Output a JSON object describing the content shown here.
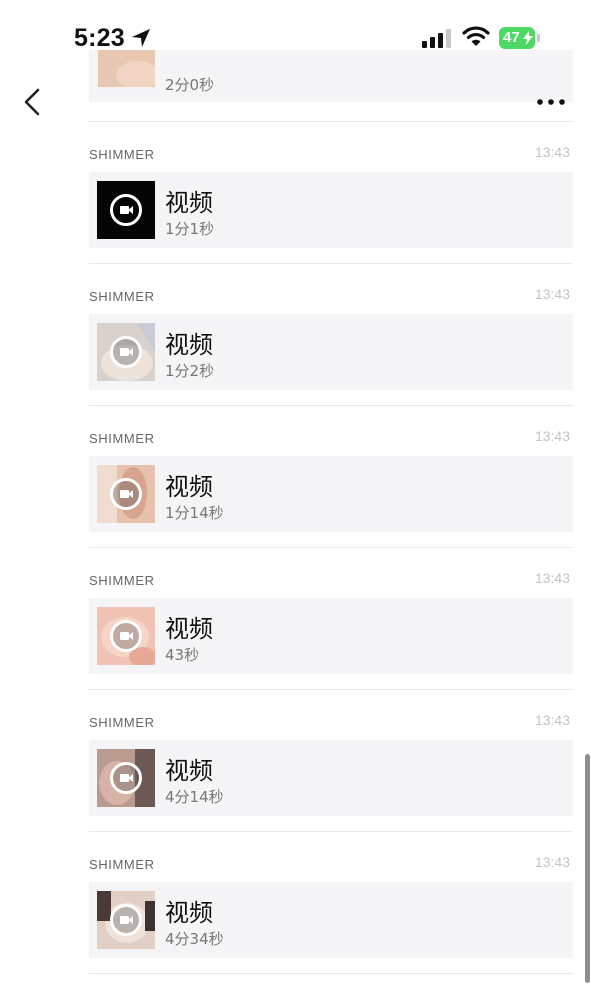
{
  "status_bar": {
    "time": "5:23",
    "battery": "47",
    "icons": [
      "location-arrow-icon",
      "cellular-signal-icon",
      "wifi-icon",
      "battery-charging-icon"
    ],
    "battery_color": "#4cd964"
  },
  "nav": {
    "back_icon": "chevron-left-icon",
    "more_icon": "ellipsis-icon"
  },
  "partial_item": {
    "duration": "2分0秒"
  },
  "messages": [
    {
      "sender": "SHIMMER",
      "time": "13:43",
      "title": "视频",
      "duration": "1分1秒",
      "icon": "video-camera-icon"
    },
    {
      "sender": "SHIMMER",
      "time": "13:43",
      "title": "视频",
      "duration": "1分2秒",
      "icon": "video-camera-icon"
    },
    {
      "sender": "SHIMMER",
      "time": "13:43",
      "title": "视频",
      "duration": "1分14秒",
      "icon": "video-camera-icon"
    },
    {
      "sender": "SHIMMER",
      "time": "13:43",
      "title": "视频",
      "duration": "43秒",
      "icon": "video-camera-icon"
    },
    {
      "sender": "SHIMMER",
      "time": "13:43",
      "title": "视频",
      "duration": "4分14秒",
      "icon": "video-camera-icon"
    },
    {
      "sender": "SHIMMER",
      "time": "13:43",
      "title": "视频",
      "duration": "4分34秒",
      "icon": "video-camera-icon"
    }
  ],
  "colors": {
    "card_background": "#f5f5f7",
    "timestamp": "#c4c4c4",
    "sender": "#666666"
  }
}
